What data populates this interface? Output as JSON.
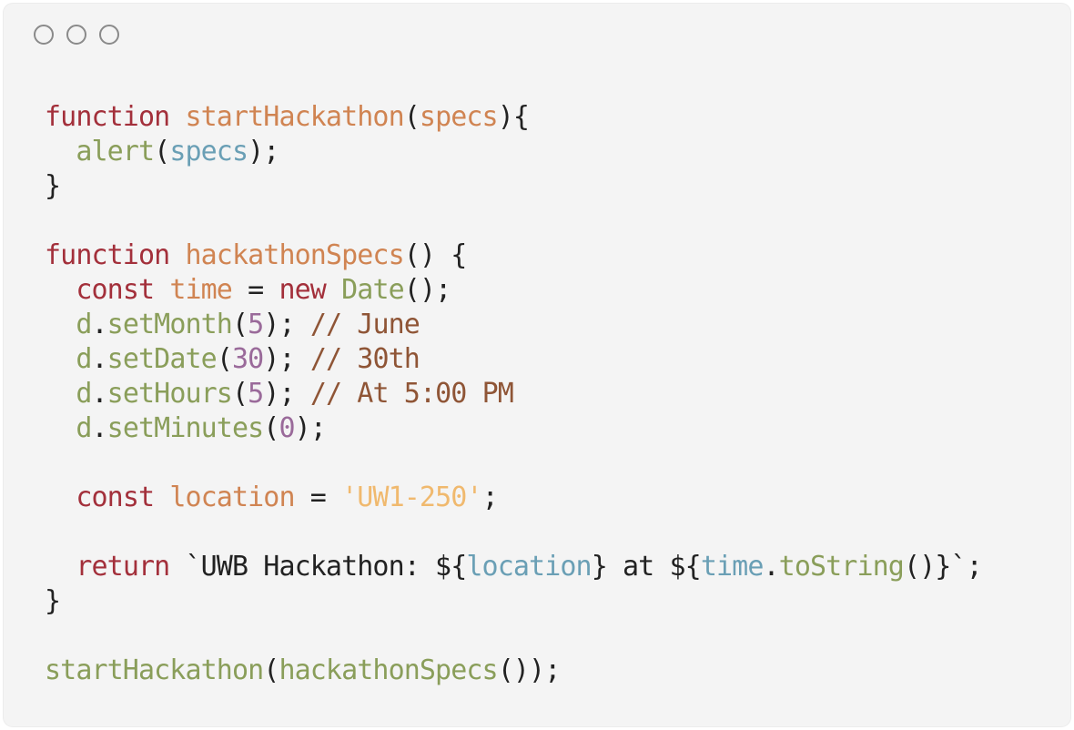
{
  "window": {
    "controls": [
      "window-control-1",
      "window-control-2",
      "window-control-3"
    ]
  },
  "colors": {
    "keyword": "#a3303b",
    "function_name": "#d08452",
    "call": "#8a9e5a",
    "param": "#6a9fb5",
    "number": "#9a6a9a",
    "string": "#f0b96e",
    "comment": "#8f5536",
    "plain": "#222222"
  },
  "lines": [
    [
      {
        "text": "function",
        "style": "keyword"
      },
      {
        "text": " ",
        "style": "plain"
      },
      {
        "text": "startHackathon",
        "style": "function_name"
      },
      {
        "text": "(",
        "style": "plain"
      },
      {
        "text": "specs",
        "style": "function_name"
      },
      {
        "text": "){",
        "style": "plain"
      }
    ],
    [
      {
        "text": "  ",
        "style": "plain"
      },
      {
        "text": "alert",
        "style": "call"
      },
      {
        "text": "(",
        "style": "plain"
      },
      {
        "text": "specs",
        "style": "param"
      },
      {
        "text": ");",
        "style": "plain"
      }
    ],
    [
      {
        "text": "}",
        "style": "plain"
      }
    ],
    [],
    [
      {
        "text": "function",
        "style": "keyword"
      },
      {
        "text": " ",
        "style": "plain"
      },
      {
        "text": "hackathonSpecs",
        "style": "function_name"
      },
      {
        "text": "() {",
        "style": "plain"
      }
    ],
    [
      {
        "text": "  ",
        "style": "plain"
      },
      {
        "text": "const",
        "style": "keyword"
      },
      {
        "text": " ",
        "style": "plain"
      },
      {
        "text": "time",
        "style": "function_name"
      },
      {
        "text": " = ",
        "style": "plain"
      },
      {
        "text": "new",
        "style": "keyword"
      },
      {
        "text": " ",
        "style": "plain"
      },
      {
        "text": "Date",
        "style": "call"
      },
      {
        "text": "();",
        "style": "plain"
      }
    ],
    [
      {
        "text": "  ",
        "style": "plain"
      },
      {
        "text": "d",
        "style": "call"
      },
      {
        "text": ".",
        "style": "plain"
      },
      {
        "text": "setMonth",
        "style": "call"
      },
      {
        "text": "(",
        "style": "plain"
      },
      {
        "text": "5",
        "style": "number"
      },
      {
        "text": "); ",
        "style": "plain"
      },
      {
        "text": "// June",
        "style": "comment"
      }
    ],
    [
      {
        "text": "  ",
        "style": "plain"
      },
      {
        "text": "d",
        "style": "call"
      },
      {
        "text": ".",
        "style": "plain"
      },
      {
        "text": "setDate",
        "style": "call"
      },
      {
        "text": "(",
        "style": "plain"
      },
      {
        "text": "30",
        "style": "number"
      },
      {
        "text": "); ",
        "style": "plain"
      },
      {
        "text": "// 30th",
        "style": "comment"
      }
    ],
    [
      {
        "text": "  ",
        "style": "plain"
      },
      {
        "text": "d",
        "style": "call"
      },
      {
        "text": ".",
        "style": "plain"
      },
      {
        "text": "setHours",
        "style": "call"
      },
      {
        "text": "(",
        "style": "plain"
      },
      {
        "text": "5",
        "style": "number"
      },
      {
        "text": "); ",
        "style": "plain"
      },
      {
        "text": "// At 5:00 PM",
        "style": "comment"
      }
    ],
    [
      {
        "text": "  ",
        "style": "plain"
      },
      {
        "text": "d",
        "style": "call"
      },
      {
        "text": ".",
        "style": "plain"
      },
      {
        "text": "setMinutes",
        "style": "call"
      },
      {
        "text": "(",
        "style": "plain"
      },
      {
        "text": "0",
        "style": "number"
      },
      {
        "text": ");",
        "style": "plain"
      }
    ],
    [],
    [
      {
        "text": "  ",
        "style": "plain"
      },
      {
        "text": "const",
        "style": "keyword"
      },
      {
        "text": " ",
        "style": "plain"
      },
      {
        "text": "location",
        "style": "function_name"
      },
      {
        "text": " = ",
        "style": "plain"
      },
      {
        "text": "'UW1-250'",
        "style": "string"
      },
      {
        "text": ";",
        "style": "plain"
      }
    ],
    [],
    [
      {
        "text": "  ",
        "style": "plain"
      },
      {
        "text": "return",
        "style": "keyword"
      },
      {
        "text": " `UWB Hackathon: ${",
        "style": "plain"
      },
      {
        "text": "location",
        "style": "param"
      },
      {
        "text": "} at ${",
        "style": "plain"
      },
      {
        "text": "time",
        "style": "param"
      },
      {
        "text": ".",
        "style": "plain"
      },
      {
        "text": "toString",
        "style": "call"
      },
      {
        "text": "()}`;",
        "style": "plain"
      }
    ],
    [
      {
        "text": "}",
        "style": "plain"
      }
    ],
    [],
    [
      {
        "text": "startHackathon",
        "style": "call"
      },
      {
        "text": "(",
        "style": "plain"
      },
      {
        "text": "hackathonSpecs",
        "style": "call"
      },
      {
        "text": "());",
        "style": "plain"
      }
    ]
  ]
}
